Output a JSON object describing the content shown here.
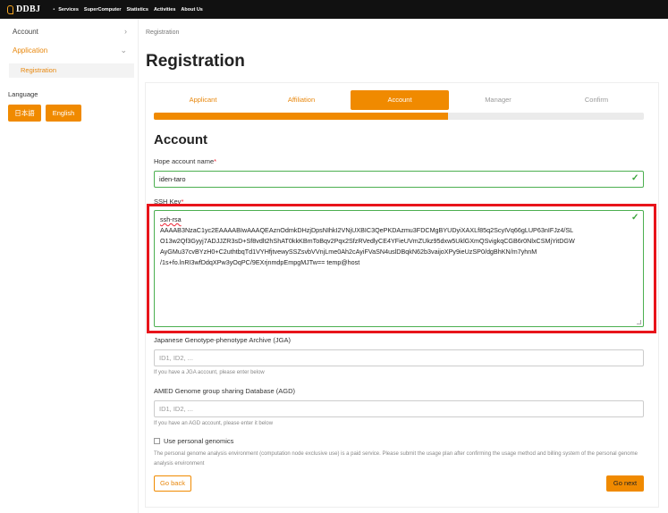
{
  "header": {
    "logo_text": "DDBJ",
    "nav": [
      "Services",
      "SuperComputer",
      "Statistics",
      "Activities",
      "About Us"
    ]
  },
  "sidebar": {
    "items": [
      {
        "label": "Account"
      },
      {
        "label": "Application"
      }
    ],
    "sub_item": "Registration",
    "language_label": "Language",
    "lang_buttons": [
      "日本語",
      "English"
    ]
  },
  "breadcrumb": "Registration",
  "page_title": "Registration",
  "steps": [
    "Applicant",
    "Affiliation",
    "Account",
    "Manager",
    "Confirm"
  ],
  "active_step": 2,
  "progress": 0.6,
  "section_title": "Account",
  "fields": {
    "hope_account": {
      "label": "Hope account name",
      "value": "iden-taro"
    },
    "ssh_key": {
      "label": "SSH Key",
      "lines": [
        "ssh-rsa",
        "AAAAB3NzaC1yc2EAAAABIwAAAQEAznOdmkDHzjDpsNIhkI2VNjUXBIC3QePKDAzmu3FDCMgBYUDyiXAXLf85q2ScyIVq66gLUP63nIFJz4/SL",
        "O13w2Qf3Gyyj7ADJJZR3sD+Sf8vdlt2hShAT0kkKBmToBqv2Pqx2SfzRVedlyCE4YFieUVmZUkz95dxw5UklGXmQSvigkqCGB6r0NlxCSMjYitDGW",
        "AyGMu37cvBYzH0+C2uthtbqTd1VYHfjtvewySSZsvbVVnjLme0Ah2cAyiFVaSN4uslDBqkN62b3vaijoXPy9ieUzSP0/dgBhKN/m7yhnM",
        "/1s+fo.lnRI3wfDdqXPw3yOqPC/9EXrjnmdpEmpgMJTw== temp@host"
      ]
    },
    "jga": {
      "label": "Japanese Genotype-phenotype Archive (JGA)",
      "placeholder": "ID1, ID2, ...",
      "help": "If you have a JGA account, please enter below"
    },
    "agd": {
      "label": "AMED Genome group sharing Database (AGD)",
      "placeholder": "ID1, ID2, ...",
      "help": "If you have an AGD account, please enter it below"
    }
  },
  "personal_genomics": {
    "label": "Use personal genomics",
    "note": "The personal genome analysis environment (computation node exclusive use) is a paid service. Please submit the usage plan after confirming the usage method and billing system of the personal genome analysis environment"
  },
  "buttons": {
    "back": "Go back",
    "next": "Go next"
  },
  "colors": {
    "accent": "#f08a00",
    "valid": "#4caf50",
    "highlight": "#e8141b"
  }
}
